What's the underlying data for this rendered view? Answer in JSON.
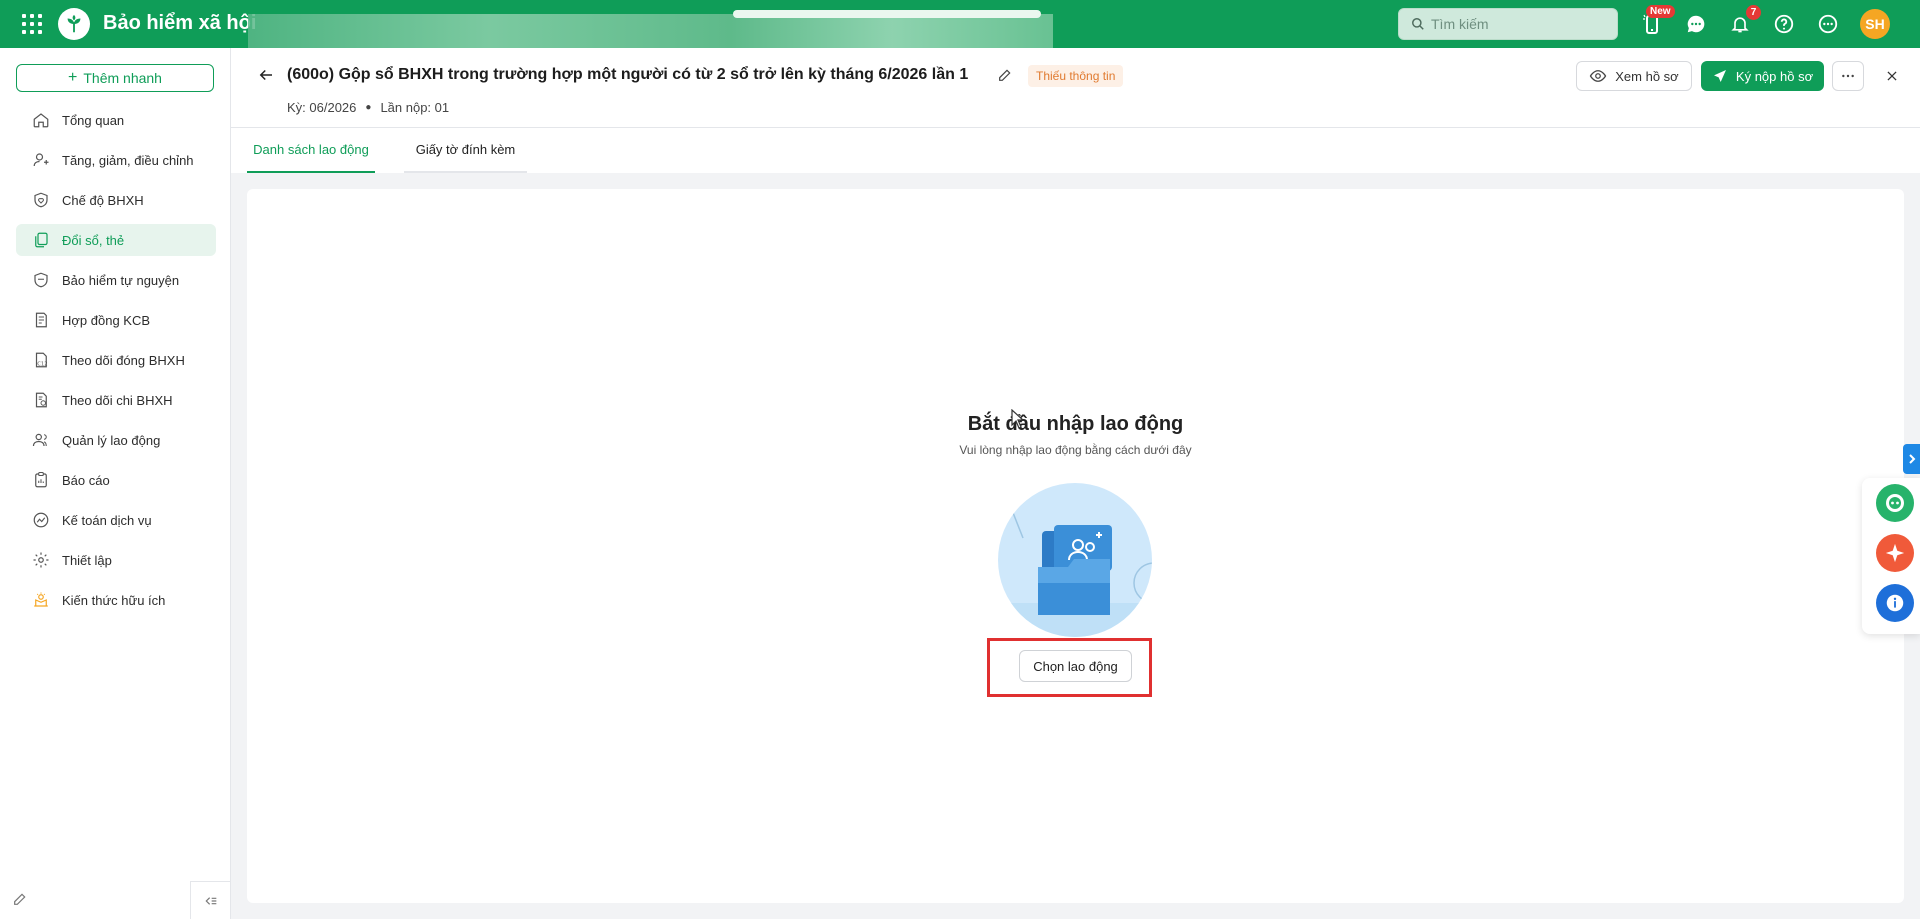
{
  "topbar": {
    "app_title": "Bảo hiểm xã hội",
    "search_placeholder": "Tìm kiếm",
    "badge_new": "New",
    "notification_count": "7",
    "avatar_initials": "SH",
    "bg_color": "#0f9d58"
  },
  "sidebar": {
    "quick_add": "Thêm nhanh",
    "items": [
      {
        "label": "Tổng quan",
        "icon": "home-icon"
      },
      {
        "label": "Tăng, giảm, điều chỉnh",
        "icon": "user-adjust-icon"
      },
      {
        "label": "Chế độ BHXH",
        "icon": "shield-heart-icon"
      },
      {
        "label": "Đổi sổ, thẻ",
        "icon": "copy-card-icon",
        "active": true
      },
      {
        "label": "Bảo hiểm tự nguyện",
        "icon": "shield-icon"
      },
      {
        "label": "Hợp đồng KCB",
        "icon": "contract-icon"
      },
      {
        "label": "Theo dõi đóng BHXH",
        "icon": "c12-doc-icon"
      },
      {
        "label": "Theo dõi chi BHXH",
        "icon": "doc-money-icon"
      },
      {
        "label": "Quản lý lao động",
        "icon": "users-icon"
      },
      {
        "label": "Báo cáo",
        "icon": "report-icon"
      },
      {
        "label": "Kế toán dịch vụ",
        "icon": "chart-circle-icon"
      },
      {
        "label": "Thiết lập",
        "icon": "gear-icon"
      },
      {
        "label": "Kiến thức hữu ích",
        "icon": "lightbulb-book-icon"
      }
    ]
  },
  "header": {
    "title": "(600o) Gộp sổ BHXH trong trường hợp một người có từ 2 sổ trở lên kỳ tháng 6/2026 lần 1",
    "status": "Thiếu thông tin",
    "period": "Kỳ: 06/2026",
    "submission": "Lần nộp: 01",
    "view_button": "Xem hồ sơ",
    "submit_button": "Ký nộp hồ sơ"
  },
  "tabs": [
    {
      "label": "Danh sách lao động",
      "active": true
    },
    {
      "label": "Giấy tờ đính kèm",
      "active": false
    }
  ],
  "empty_state": {
    "title": "Bắt đầu nhập lao động",
    "subtitle": "Vui lòng nhập lao động bằng cách dưới đây",
    "button": "Chọn lao động"
  },
  "colors": {
    "primary": "#0f9d58",
    "status_badge_text": "#e07a2f",
    "status_badge_bg": "#fdf0e6",
    "highlight": "#e03030"
  }
}
